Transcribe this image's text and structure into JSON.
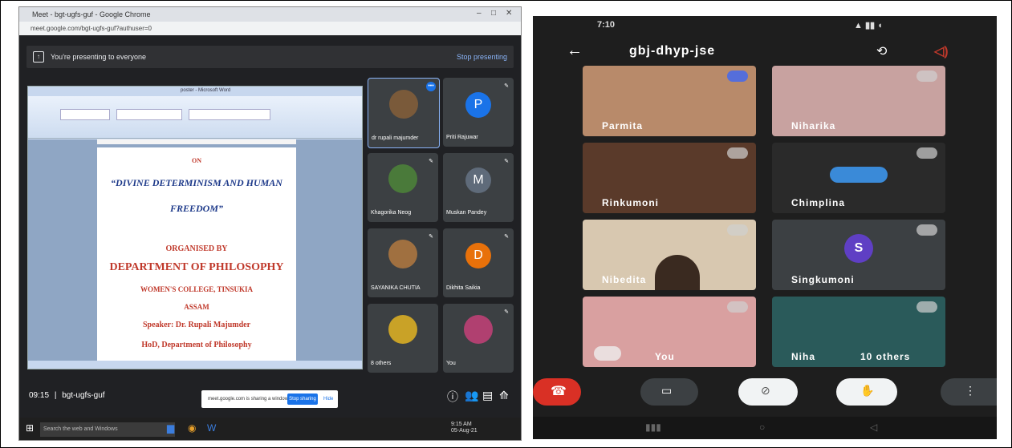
{
  "desktop": {
    "window_title": "Meet - bgt-ugfs-guf - Google Chrome",
    "url": "meet.google.com/bgt-ugfs-guf?authuser=0",
    "presenting_text": "You're presenting to everyone",
    "stop_presenting": "Stop presenting",
    "word_title": "poster - Microsoft Word",
    "document": {
      "on": "ON",
      "title_line1": "“DIVINE DETERMINISM AND HUMAN",
      "title_line2": "FREEDOM”",
      "organised_by": "ORGANISED BY",
      "department": "DEPARTMENT OF PHILOSOPHY",
      "college": "WOMEN'S COLLEGE, TINSUKIA",
      "state": "ASSAM",
      "speaker": "Speaker: Dr. Rupali Majumder",
      "hod": "HoD, Department of Philosophy"
    },
    "participants": [
      {
        "name": "dr rupali majumder",
        "avatar": "",
        "color": "#7a5a3a"
      },
      {
        "name": "Priti Rajuwar",
        "avatar": "P",
        "color": "#1a73e8"
      },
      {
        "name": "Khagorika Neog",
        "avatar": "",
        "color": "#4a7a3a"
      },
      {
        "name": "Muskan Pandey",
        "avatar": "M",
        "color": "#5f6b7a"
      },
      {
        "name": "SAYANIKA CHUTIA",
        "avatar": "",
        "color": "#a07040"
      },
      {
        "name": "Dikhita Saikia",
        "avatar": "D",
        "color": "#e8710a"
      },
      {
        "name": "8 others",
        "avatar": "",
        "color": "#c9a227"
      },
      {
        "name": "You",
        "avatar": "",
        "color": "#b04070"
      }
    ],
    "meeting_time": "09:15",
    "meeting_code": "bgt-ugfs-guf",
    "share_notice": "meet.google.com is sharing a window.",
    "stop_sharing": "Stop sharing",
    "hide": "Hide",
    "taskbar_search": "Search the web and Windows",
    "clock_time": "9:15 AM",
    "clock_date": "05-Aug-21"
  },
  "phone": {
    "status_time": "7:10",
    "meeting_code": "gbj-dhyp-jse",
    "participants": [
      {
        "name": "Parmita",
        "bg": "#b88a6a"
      },
      {
        "name": "Niharika",
        "bg": "#c8a2a0"
      },
      {
        "name": "Rinkumoni",
        "bg": "#5a3a2a"
      },
      {
        "name": "Chimplina",
        "bg": "#2a2a2a"
      },
      {
        "name": "Nibedita",
        "bg": "#d8c8b0"
      },
      {
        "name": "Singkumoni",
        "avatar": "S",
        "bg": "#3c4043"
      },
      {
        "name": "You",
        "bg": "#d9a0a0"
      },
      {
        "name": "Niha",
        "bg": "#2a5a5a"
      }
    ],
    "others_label": "10 others"
  }
}
